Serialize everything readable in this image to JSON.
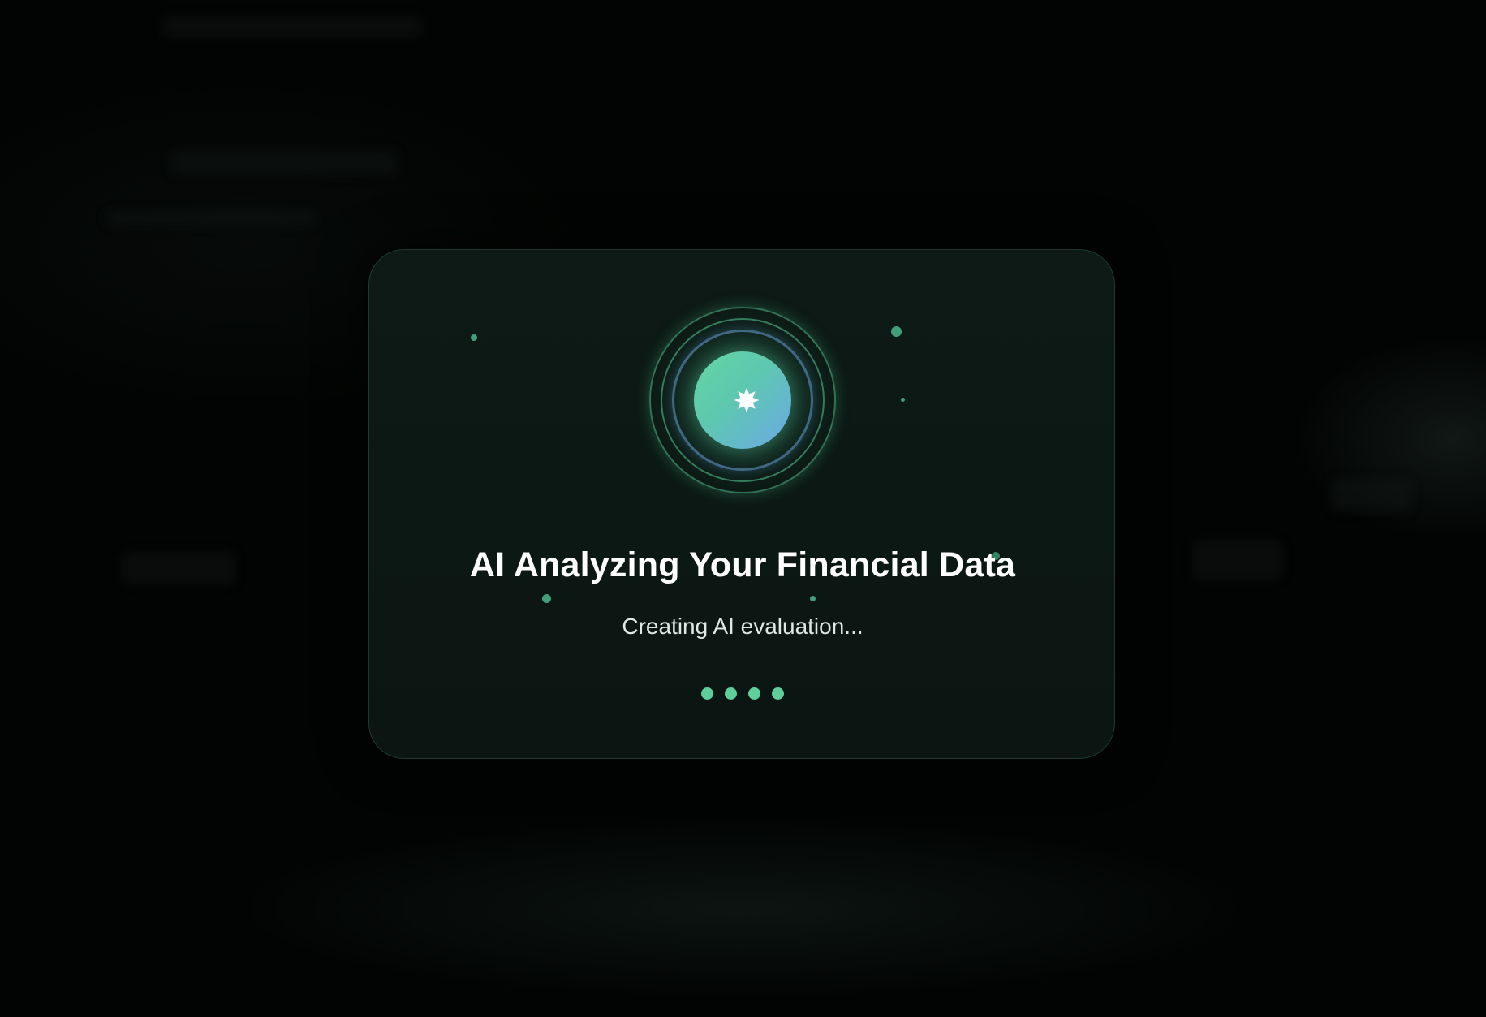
{
  "dialog": {
    "title": "AI Analyzing Your Financial Data",
    "status": "Creating AI evaluation...",
    "progress_dots": 4
  },
  "icons": {
    "core": "sparkle-icon"
  },
  "colors": {
    "accent": "#5ecf98",
    "orb_start": "#64d6a3",
    "orb_end": "#6ba9e8",
    "card_bg": "#0d1a15",
    "page_bg": "#020403"
  }
}
